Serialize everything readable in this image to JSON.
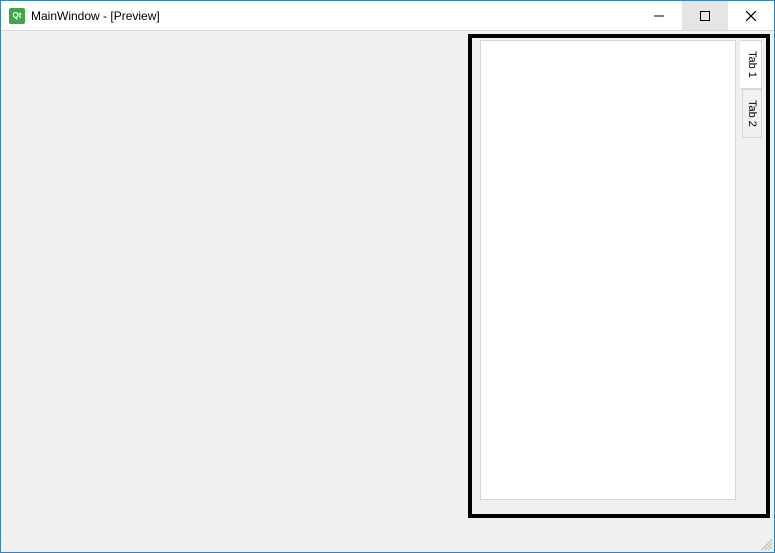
{
  "window": {
    "title": "MainWindow - [Preview]",
    "app_icon_label": "Qt"
  },
  "tabs": {
    "items": [
      {
        "label": "Tab 1",
        "active": true
      },
      {
        "label": "Tab 2",
        "active": false
      }
    ]
  }
}
